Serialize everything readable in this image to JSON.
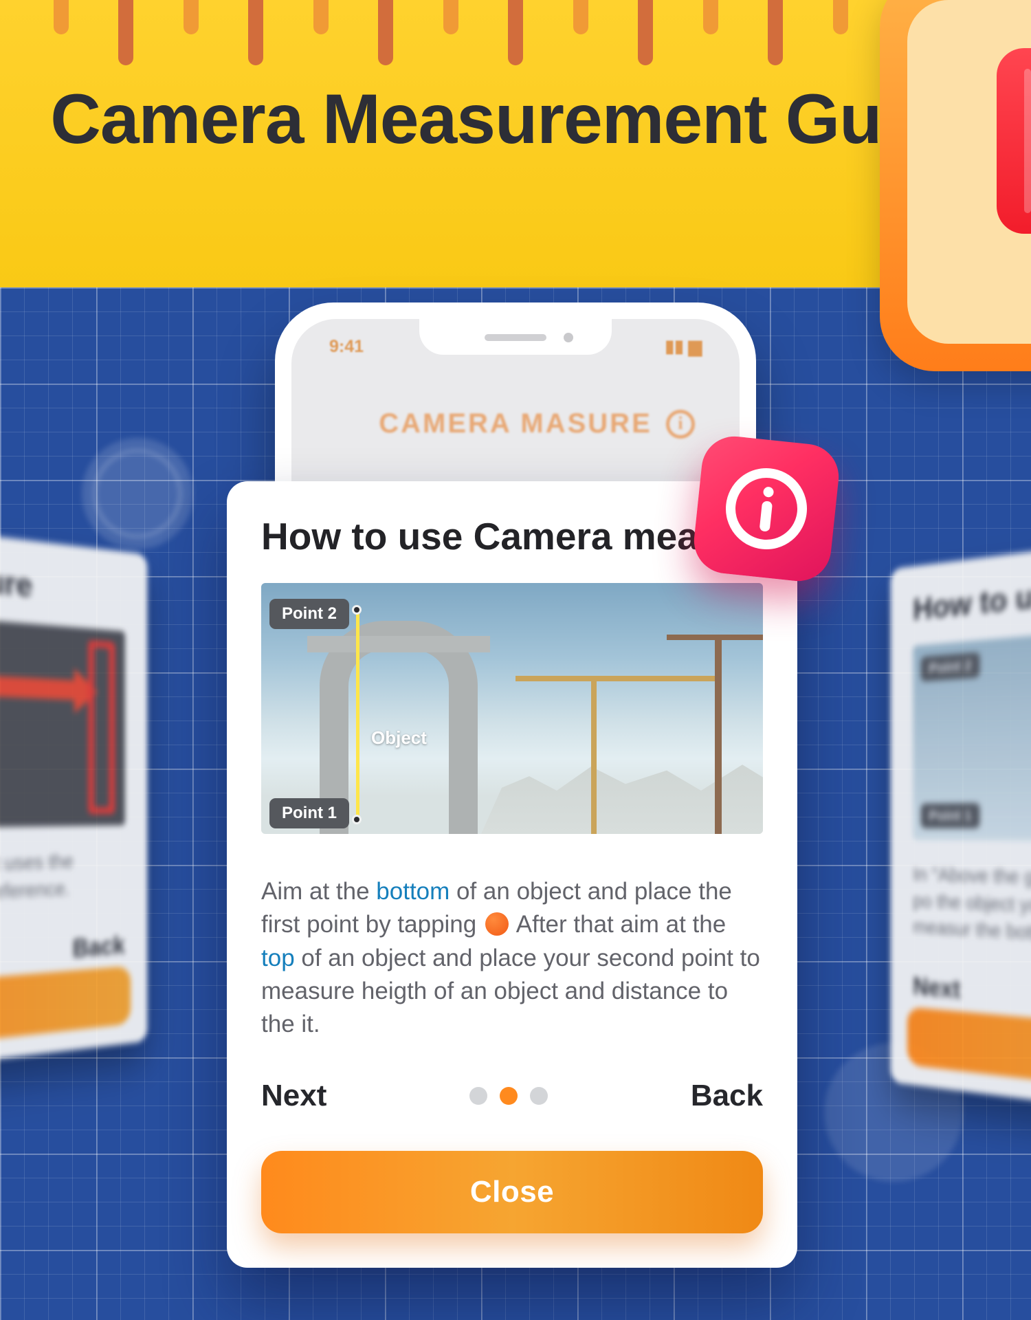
{
  "header": {
    "title": "Camera Measurement Guide"
  },
  "phone": {
    "status_time": "9:41",
    "app_title": "CAMERA MASURE"
  },
  "modal": {
    "title": "How to use Camera measure",
    "image": {
      "point_top_label": "Point 2",
      "point_bottom_label": "Point 1",
      "object_label": "Object"
    },
    "instruction": {
      "seg1": "Aim at the ",
      "hl1": "bottom",
      "seg2": " of an object and place the first point by tapping ",
      "seg3": " After that aim at the ",
      "hl2": "top",
      "seg4": " of an object and place your second point to measure heigth of an object and distance to the it."
    },
    "nav": {
      "next": "Next",
      "back": "Back",
      "page_count": 3,
      "active_index": 1
    },
    "close_label": "Close"
  },
  "side_cards": {
    "left": {
      "title": "era measure",
      "text": "he ground\" to get uses the distance d as a reference.",
      "nav_label": "Back"
    },
    "right": {
      "title": "How to use C",
      "text": "In \"Above the gr place the first po the object you m continue measur the bottom and to",
      "nav_label": "Next",
      "pill_top": "Point 2",
      "pill_bot": "Point 1"
    }
  },
  "colors": {
    "accent_orange": "#ff8a1c",
    "accent_pink": "#ff2f62",
    "highlight_blue": "#157fbc",
    "banner_yellow": "#f9c915"
  }
}
